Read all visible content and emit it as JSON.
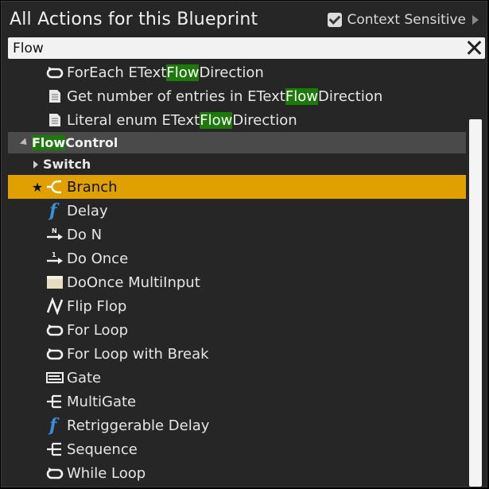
{
  "header": {
    "title": "All Actions for this Blueprint",
    "context_sensitive_label": "Context Sensitive",
    "context_sensitive_checked": true
  },
  "search": {
    "value": "Flow"
  },
  "items_top": [
    {
      "pre": "ForEach EText",
      "hl": "Flow",
      "post": "Direction",
      "icon": "loop-icon"
    },
    {
      "pre": "Get number of entries in EText",
      "hl": "Flow",
      "post": "Direction",
      "icon": "document-icon"
    },
    {
      "pre": "Literal enum EText",
      "hl": "Flow",
      "post": "Direction",
      "icon": "document-icon"
    }
  ],
  "category": {
    "hl": "Flow",
    "post": " Control"
  },
  "subcategory": "Switch",
  "items": [
    {
      "label": "Branch",
      "icon": "branch-icon",
      "selected": true,
      "favorite": true
    },
    {
      "label": "Delay",
      "icon": "function-icon"
    },
    {
      "label": "Do N",
      "icon": "do-n-icon"
    },
    {
      "label": "Do Once",
      "icon": "do-once-icon"
    },
    {
      "label": "DoOnce MultiInput",
      "icon": "macro-node-icon"
    },
    {
      "label": "Flip Flop",
      "icon": "flip-flop-icon"
    },
    {
      "label": "For Loop",
      "icon": "loop-icon"
    },
    {
      "label": "For Loop with Break",
      "icon": "loop-icon"
    },
    {
      "label": "Gate",
      "icon": "gate-icon"
    },
    {
      "label": "MultiGate",
      "icon": "multigate-icon"
    },
    {
      "label": "Retriggerable Delay",
      "icon": "function-icon"
    },
    {
      "label": "Sequence",
      "icon": "sequence-icon"
    },
    {
      "label": "While Loop",
      "icon": "loop-icon"
    }
  ],
  "colors": {
    "highlight": "#1d7a0a",
    "selected": "#e0a000",
    "function_icon": "#3a8fd8"
  }
}
